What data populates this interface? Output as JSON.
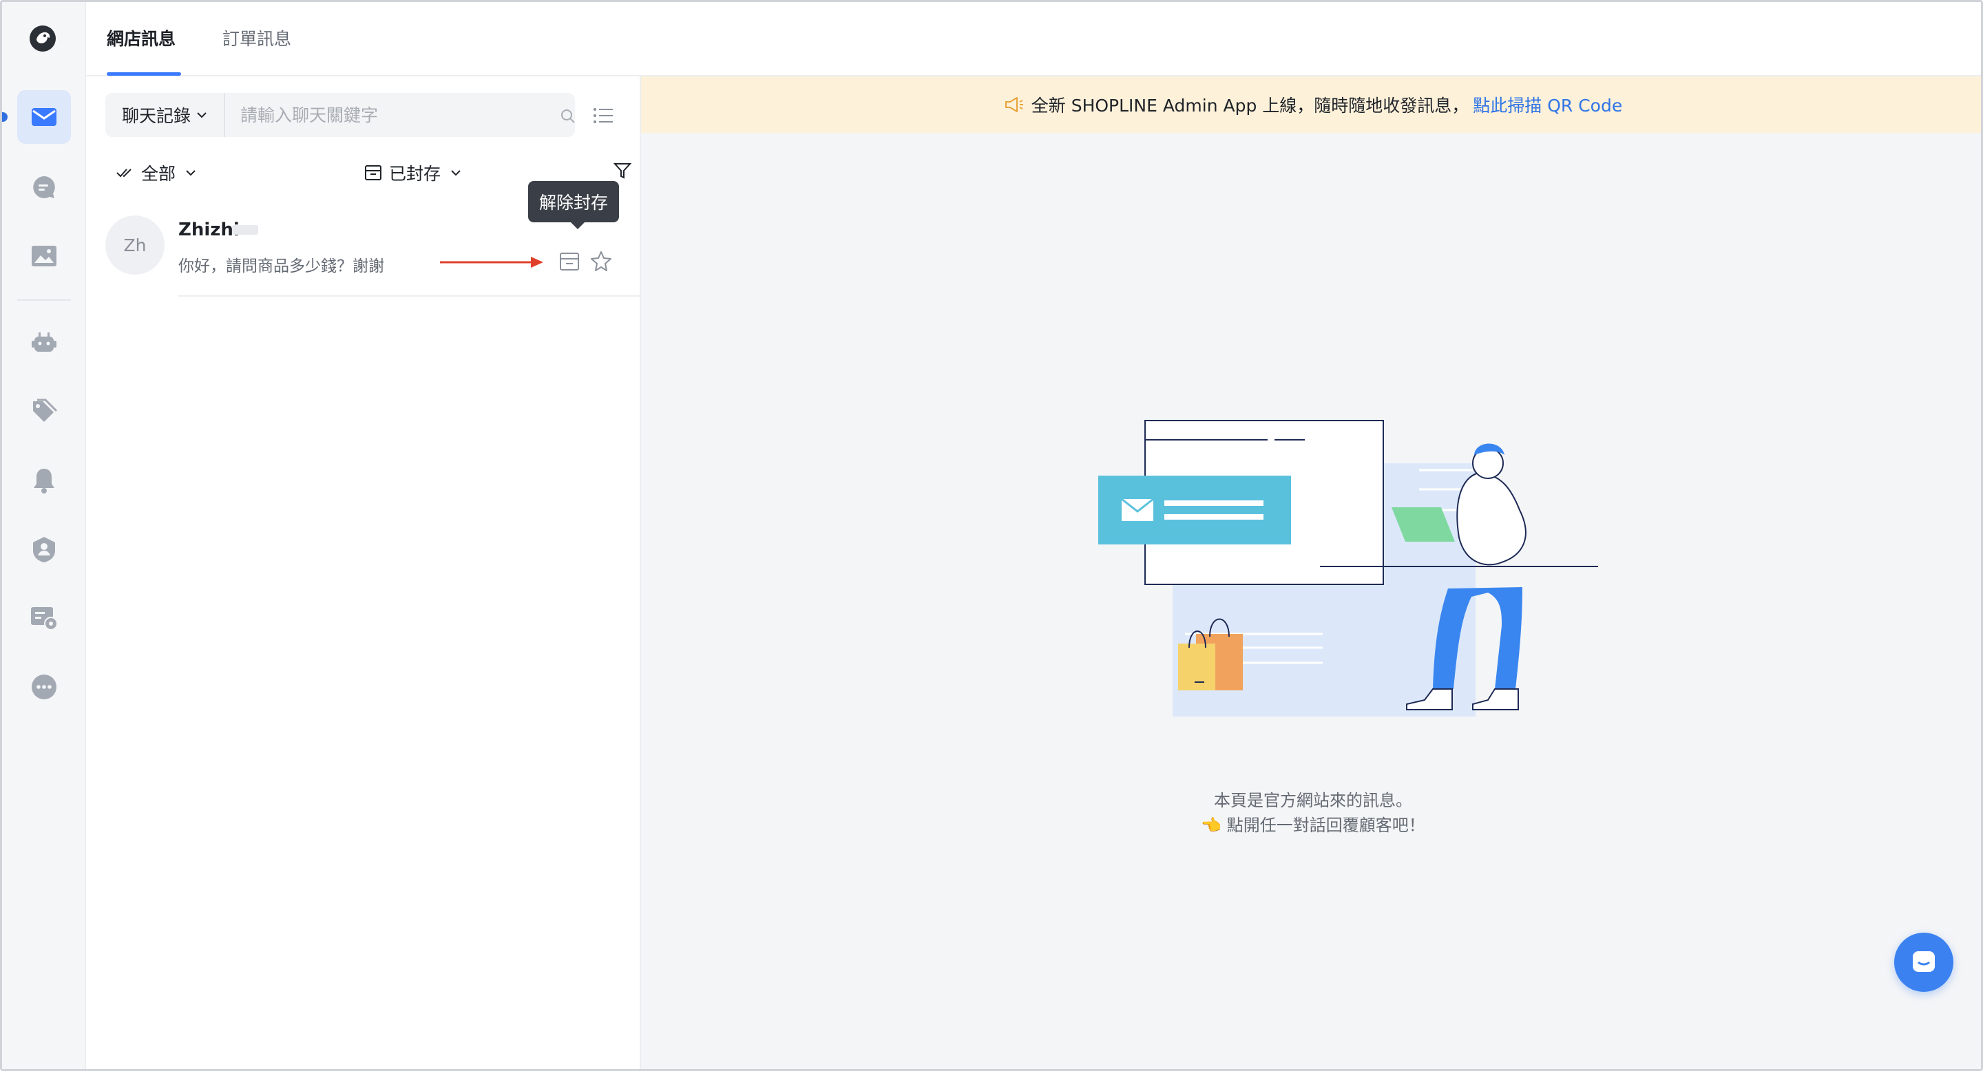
{
  "tabs": [
    {
      "label": "網店訊息",
      "active": true
    },
    {
      "label": "訂單訊息",
      "active": false
    }
  ],
  "sidebar": {
    "items": [
      {
        "icon": "mail-icon",
        "active": true
      },
      {
        "icon": "chat-bubble-icon",
        "active": false
      },
      {
        "icon": "image-icon",
        "active": false
      },
      {
        "icon": "robot-icon",
        "active": false
      },
      {
        "icon": "tag-icon",
        "active": false
      },
      {
        "icon": "bell-icon",
        "active": false
      },
      {
        "icon": "user-shield-icon",
        "active": false
      },
      {
        "icon": "message-settings-icon",
        "active": false
      },
      {
        "icon": "more-icon",
        "active": false
      }
    ]
  },
  "search": {
    "scope_label": "聊天記錄",
    "placeholder": "請輸入聊天關鍵字"
  },
  "filters": {
    "read_label": "全部",
    "archive_label": "已封存"
  },
  "conversation": {
    "avatar_initials": "Zh",
    "name": "Zhizhi",
    "message": "你好，請問商品多少錢？謝謝",
    "tooltip": "解除封存"
  },
  "banner": {
    "text": "全新 SHOPLINE Admin App 上線，隨時隨地收發訊息，",
    "link": "點此掃描 QR Code"
  },
  "empty_state": {
    "line1": "本頁是官方網站來的訊息。",
    "line2": "👈 點開任一對話回覆顧客吧！"
  },
  "colors": {
    "accent": "#3a7afe",
    "banner_bg": "#fdf1d9",
    "link": "#2f74e6",
    "arrow": "#e0402a"
  }
}
